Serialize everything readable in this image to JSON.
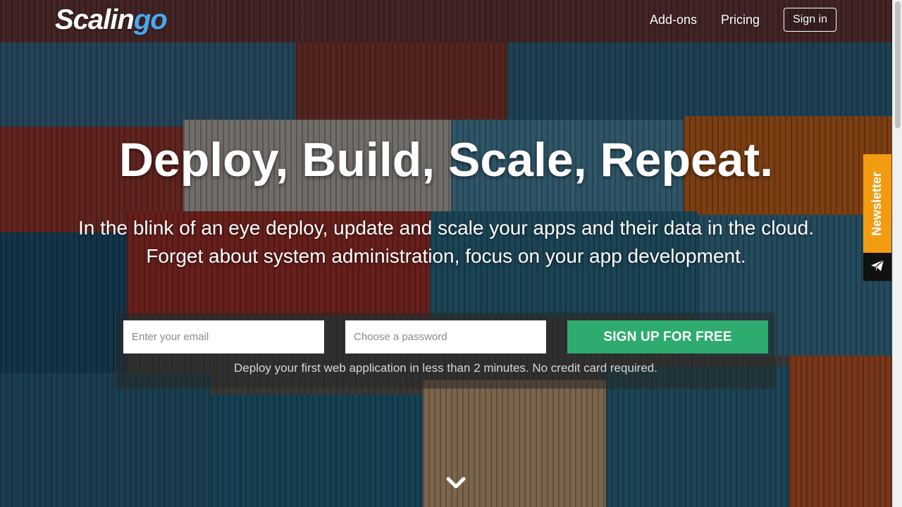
{
  "brand": {
    "name_main": "Scalin",
    "name_accent": "go"
  },
  "nav": {
    "addons": "Add-ons",
    "pricing": "Pricing",
    "signin": "Sign in"
  },
  "hero": {
    "headline": "Deploy, Build, Scale, Repeat.",
    "subline_1": "In the blink of an eye deploy, update and scale your apps and their data in the cloud.",
    "subline_2": "Forget about system administration, focus on your app development."
  },
  "signup": {
    "email_placeholder": "Enter your email",
    "email_value": "",
    "password_placeholder": "Choose a password",
    "password_value": "",
    "button_label": "SIGN UP FOR FREE",
    "note": "Deploy your first web application in less than 2 minutes. No credit card required."
  },
  "newsletter": {
    "label": "Newsletter",
    "icon": "paper-plane-icon"
  },
  "icons": {
    "scroll_down": "chevron-down-icon"
  },
  "colors": {
    "accent_blue": "#4aa8f0",
    "signup_green": "#2eab6f",
    "newsletter_orange": "#f39c12"
  }
}
